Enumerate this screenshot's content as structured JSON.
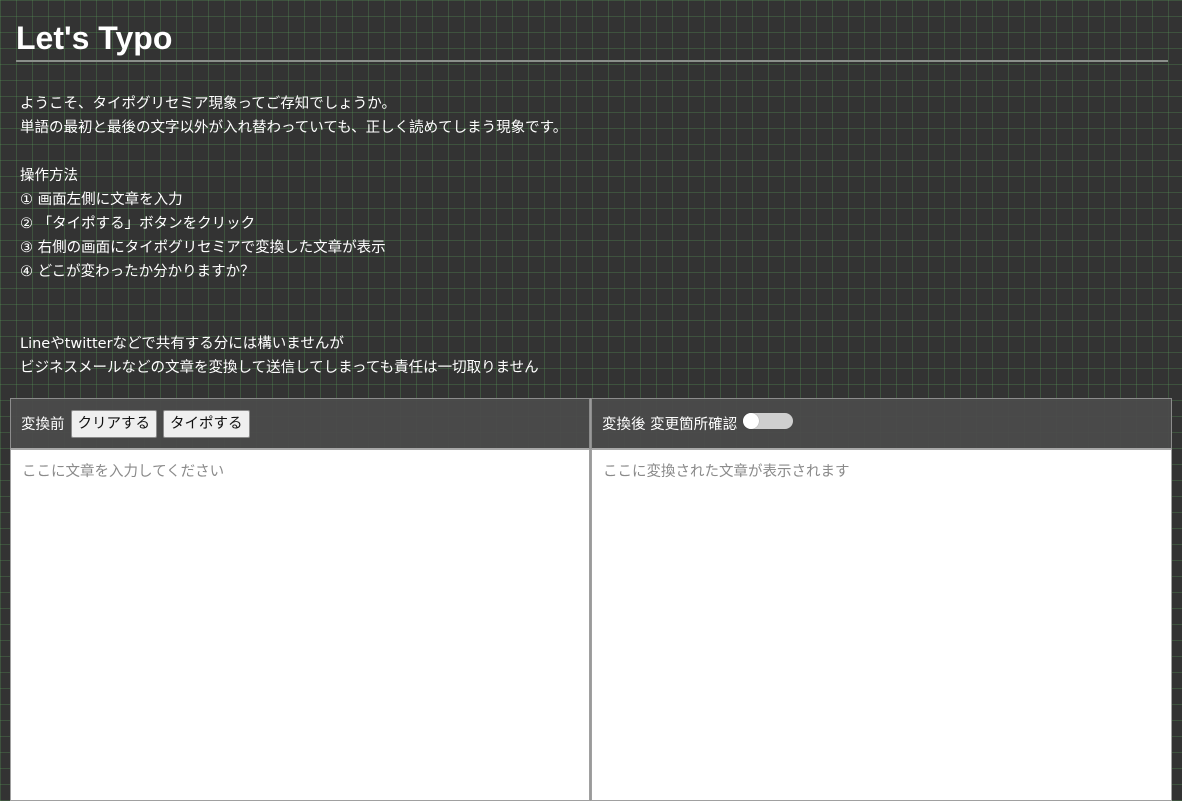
{
  "header": {
    "title": "Let's Typo"
  },
  "intro": {
    "line1": "ようこそ、タイポグリセミア現象ってご存知でしょうか。",
    "line2": "単語の最初と最後の文字以外が入れ替わっていても、正しく読めてしまう現象です。",
    "howto_heading": "操作方法",
    "steps": [
      "① 画面左側に文章を入力",
      "② 「タイポする」ボタンをクリック",
      "③ 右側の画面にタイポグリセミアで変換した文章が表示",
      "④ どこが変わったか分かりますか？"
    ],
    "note1": "Lineやtwitterなどで共有する分には構いませんが",
    "note2": "ビジネスメールなどの文章を変換して送信してしまっても責任は一切取りません"
  },
  "left_panel": {
    "label": "変換前",
    "clear_button": "クリアする",
    "typo_button": "タイポする",
    "input_placeholder": "ここに文章を入力してください",
    "input_value": ""
  },
  "right_panel": {
    "label": "変換後 変更箇所確認",
    "toggle_on": false,
    "output_placeholder": "ここに変換された文章が表示されます"
  }
}
